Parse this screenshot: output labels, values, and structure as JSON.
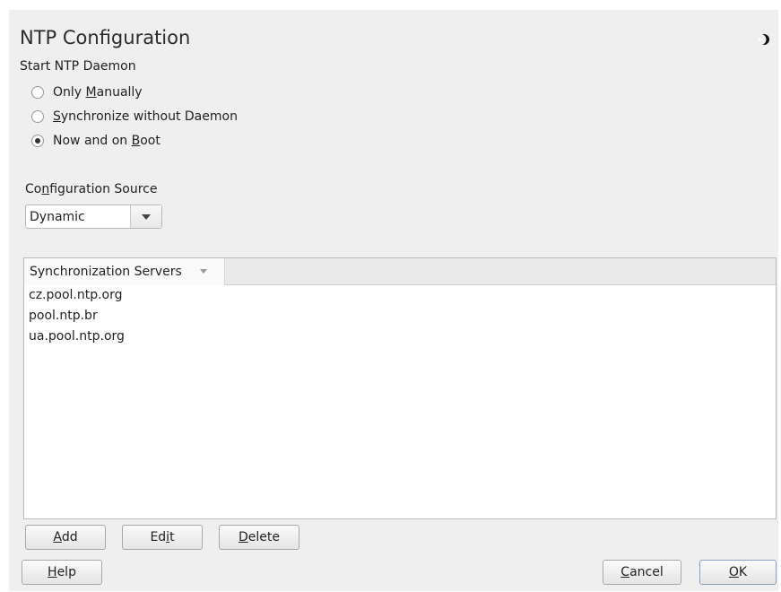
{
  "dialog": {
    "title": "NTP Configuration"
  },
  "start_daemon": {
    "label": "Start NTP Daemon",
    "options": [
      {
        "pre": "Only ",
        "key": "M",
        "post": "anually",
        "selected": false
      },
      {
        "pre": "",
        "key": "S",
        "post": "ynchronize without Daemon",
        "selected": false
      },
      {
        "pre": "Now and on ",
        "key": "B",
        "post": "oot",
        "selected": true
      }
    ]
  },
  "config_source": {
    "label_pre": "Co",
    "label_key": "n",
    "label_post": "figuration Source",
    "value": "Dynamic"
  },
  "servers_table": {
    "header": "Synchronization Servers",
    "rows": [
      "cz.pool.ntp.org",
      "pool.ntp.br",
      "ua.pool.ntp.org"
    ]
  },
  "table_buttons": {
    "add": {
      "pre": "",
      "key": "A",
      "post": "dd"
    },
    "edit": {
      "pre": "Ed",
      "key": "i",
      "post": "t"
    },
    "delete": {
      "pre": "",
      "key": "D",
      "post": "elete"
    }
  },
  "footer_buttons": {
    "help": {
      "pre": "",
      "key": "H",
      "post": "elp"
    },
    "cancel": {
      "pre": "",
      "key": "C",
      "post": "ancel"
    },
    "ok": {
      "pre": "",
      "key": "O",
      "post": "K"
    }
  },
  "colors": {
    "window_bg": "#efefef",
    "table_bg": "#ffffff",
    "default_button_border": "#8aa2bd"
  }
}
